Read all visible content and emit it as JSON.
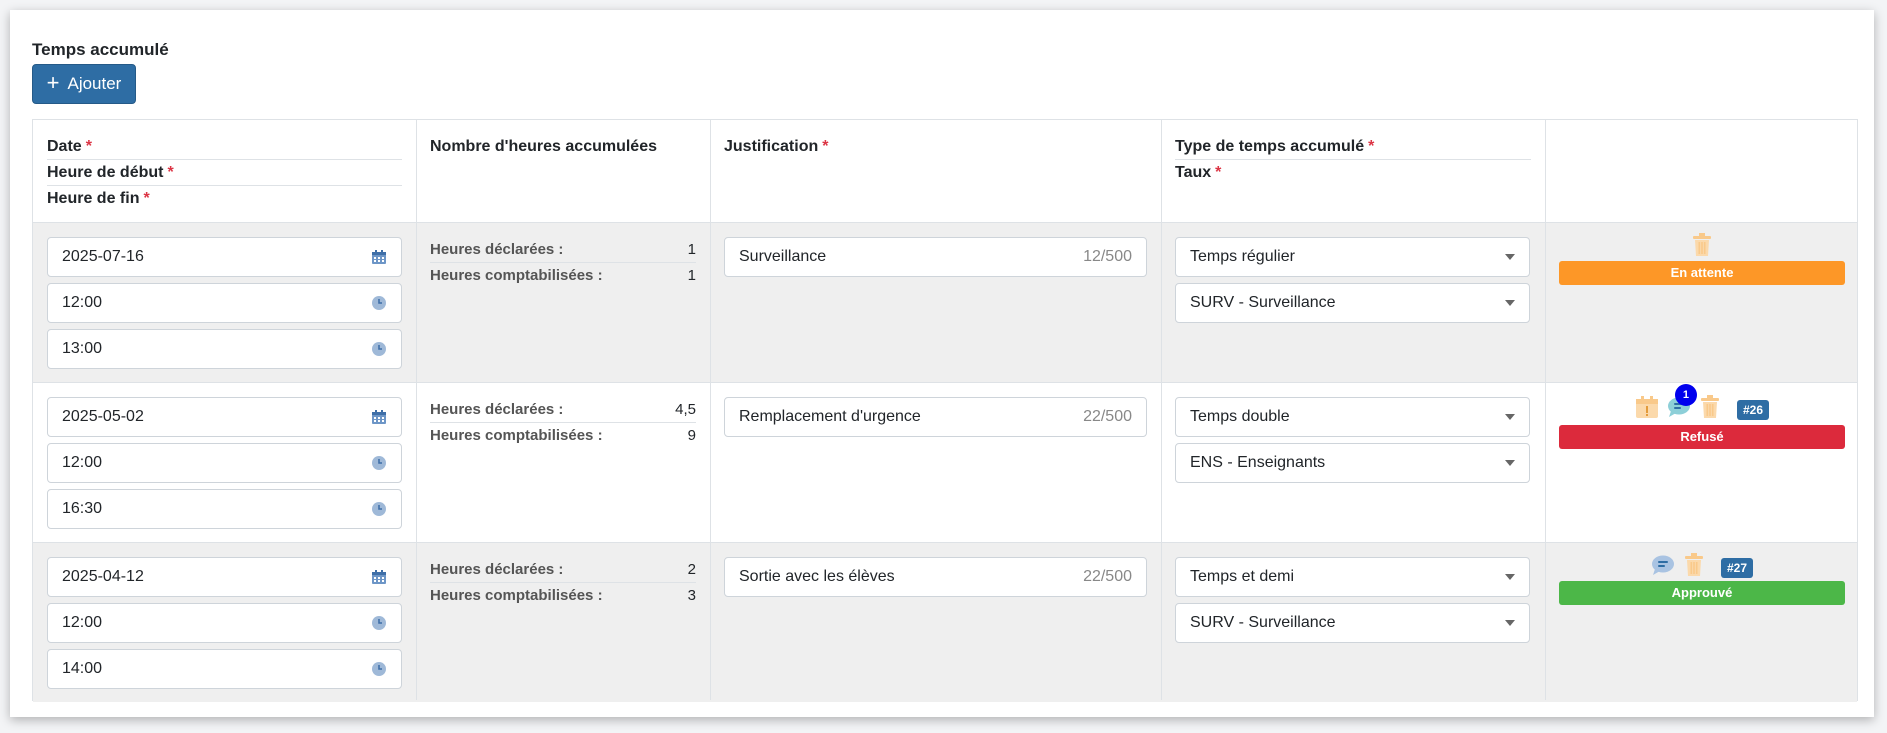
{
  "section_title": "Temps accumulé",
  "add_button": {
    "label": "Ajouter"
  },
  "headers": {
    "date": "Date",
    "start": "Heure de début",
    "end": "Heure de fin",
    "hours": "Nombre d'heures accumulées",
    "justification": "Justification",
    "type": "Type de temps accumulé",
    "rate": "Taux",
    "required_mark": "*"
  },
  "hours_labels": {
    "declared": "Heures déclarées :",
    "counted": "Heures comptabilisées :"
  },
  "rows": [
    {
      "date": "2025-07-16",
      "start": "12:00",
      "end": "13:00",
      "declared": "1",
      "counted": "1",
      "justification": "Surveillance",
      "counter": "12/500",
      "type": "Temps régulier",
      "rate": "SURV - Surveillance",
      "status": "En attente",
      "status_color": "#fd9727",
      "ref": "",
      "notif_count": ""
    },
    {
      "date": "2025-05-02",
      "start": "12:00",
      "end": "16:30",
      "declared": "4,5",
      "counted": "9",
      "justification": "Remplacement d'urgence",
      "counter": "22/500",
      "type": "Temps double",
      "rate": "ENS - Enseignants",
      "status": "Refusé",
      "status_color": "#dc2a3c",
      "ref": "#26",
      "notif_count": "1"
    },
    {
      "date": "2025-04-12",
      "start": "12:00",
      "end": "14:00",
      "declared": "2",
      "counted": "3",
      "justification": "Sortie avec les élèves",
      "counter": "22/500",
      "type": "Temps et demi",
      "rate": "SURV - Surveillance",
      "status": "Approuvé",
      "status_color": "#4cb748",
      "ref": "#27",
      "notif_count": ""
    }
  ],
  "colors": {
    "primary": "#2e6da4",
    "required": "#dc3545",
    "icon_orange": "#f9c98a",
    "icon_blue": "#6d96c7"
  }
}
